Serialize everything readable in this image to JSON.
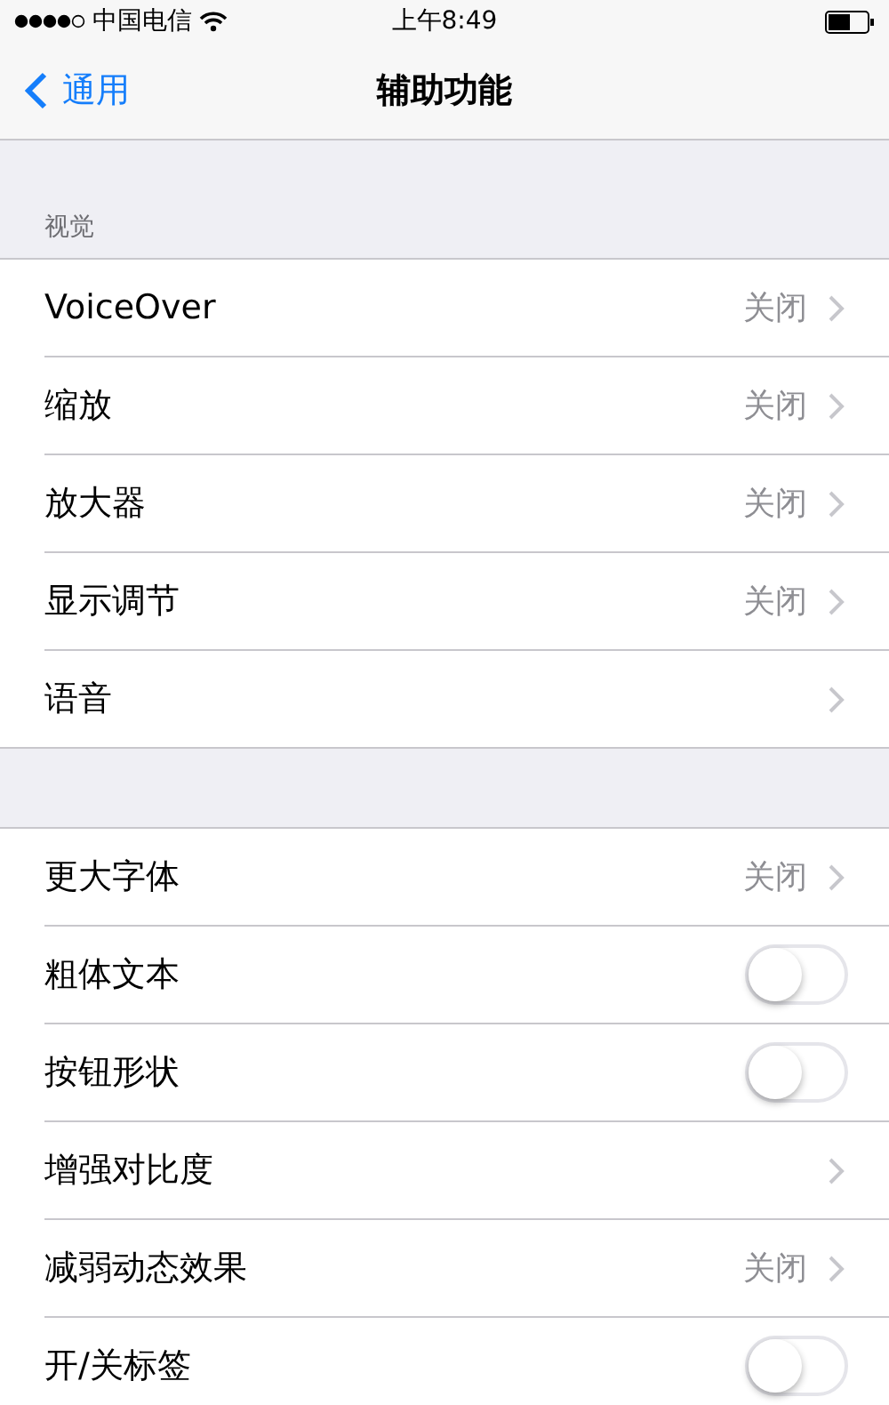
{
  "status_bar": {
    "carrier": "中国电信",
    "time": "上午8:49"
  },
  "nav": {
    "back": "通用",
    "title": "辅助功能"
  },
  "sections": [
    {
      "header": "视觉",
      "rows": [
        {
          "kind": "detail",
          "label": "VoiceOver",
          "value": "关闭"
        },
        {
          "kind": "detail",
          "label": "缩放",
          "value": "关闭"
        },
        {
          "kind": "detail",
          "label": "放大器",
          "value": "关闭"
        },
        {
          "kind": "detail",
          "label": "显示调节",
          "value": "关闭"
        },
        {
          "kind": "link",
          "label": "语音"
        }
      ]
    },
    {
      "rows": [
        {
          "kind": "detail",
          "label": "更大字体",
          "value": "关闭"
        },
        {
          "kind": "toggle",
          "label": "粗体文本",
          "on": false
        },
        {
          "kind": "toggle",
          "label": "按钮形状",
          "on": false
        },
        {
          "kind": "link",
          "label": "增强对比度"
        },
        {
          "kind": "detail",
          "label": "减弱动态效果",
          "value": "关闭"
        },
        {
          "kind": "toggle",
          "label": "开/关标签",
          "on": false
        }
      ]
    }
  ]
}
